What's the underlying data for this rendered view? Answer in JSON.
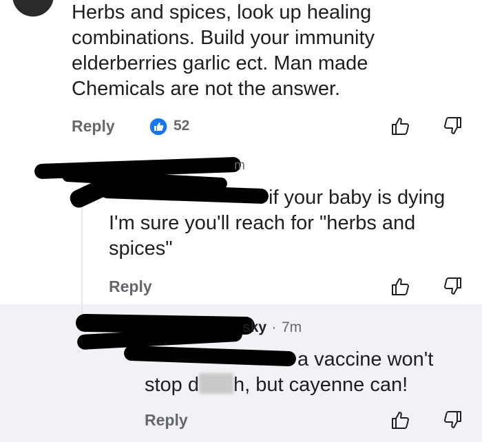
{
  "comment1": {
    "text": "Herbs and spices,  look up healing combinations.  Build your immunity elderberries garlic ect. Man made Chemicals are not the answer.",
    "reply_label": "Reply",
    "like_count": "52"
  },
  "comment2": {
    "time_fragment": "m",
    "text": "if your baby is dying I'm sure you'll reach for \"herbs and spices\"",
    "reply_label": "Reply"
  },
  "comment3": {
    "author_fragment": "sky",
    "separator": "·",
    "time": "7m",
    "text_part1": "a vaccine won't",
    "text_part2a": "stop d",
    "text_part2b": "h, but cayenne can!",
    "reply_label": "Reply"
  },
  "colors": {
    "like_blue": "#1877f2",
    "gray_text": "#65676b",
    "reply_background": "#f0f2f5"
  },
  "icons": [
    "thumbs-up-icon",
    "thumbs-down-icon",
    "like-reaction-icon"
  ]
}
